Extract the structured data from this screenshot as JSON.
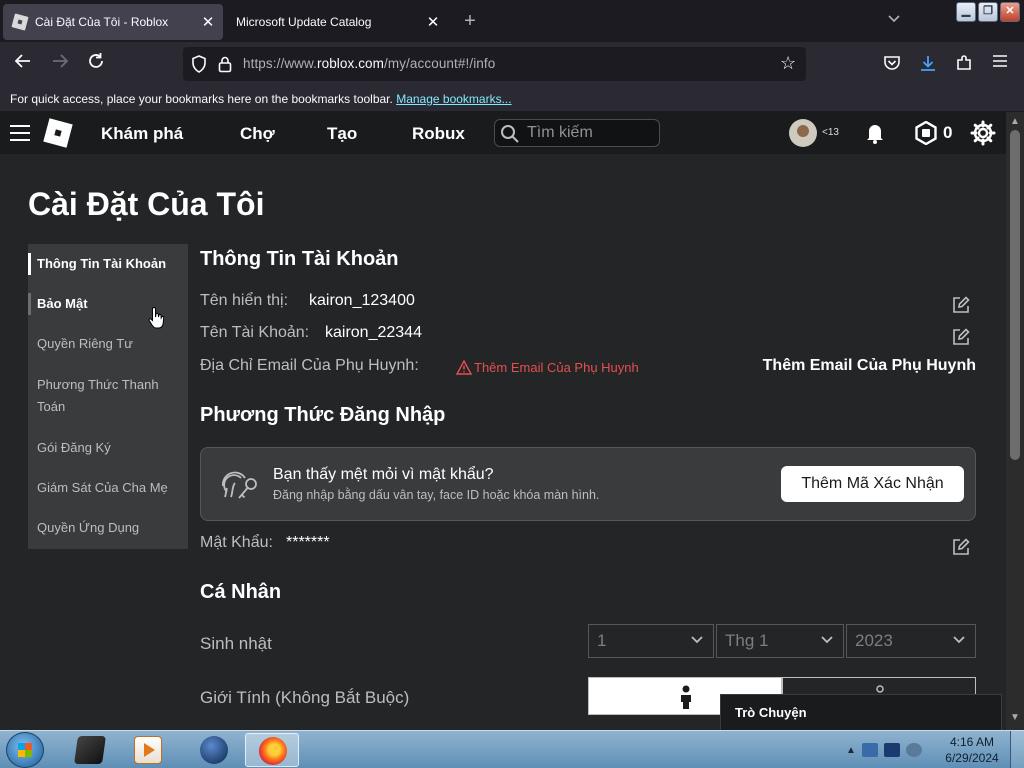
{
  "browser": {
    "tabs": [
      {
        "title": "Cài Đặt Của Tôi - Roblox",
        "active": true
      },
      {
        "title": "Microsoft Update Catalog",
        "active": false
      }
    ],
    "url_prefix": "https://www.",
    "url_host": "roblox.com",
    "url_path": "/my/account#!/info",
    "bookmarks_text": "For quick access, place your bookmarks here on the bookmarks toolbar.",
    "bookmarks_link": "Manage bookmarks..."
  },
  "header": {
    "nav": [
      "Khám phá",
      "Chợ",
      "Tạo",
      "Robux"
    ],
    "search_placeholder": "Tìm kiếm",
    "age_label": "<13",
    "robux_count": "0"
  },
  "page": {
    "title": "Cài Đặt Của Tôi",
    "sidebar": [
      {
        "label": "Thông Tin Tài Khoản",
        "state": "active"
      },
      {
        "label": "Bảo Mật",
        "state": "hover"
      },
      {
        "label": "Quyền Riêng Tư",
        "state": "normal"
      },
      {
        "label": "Phương Thức Thanh Toán",
        "state": "normal"
      },
      {
        "label": "Gói Đăng Ký",
        "state": "normal"
      },
      {
        "label": "Giám Sát Của Cha Mẹ",
        "state": "normal"
      },
      {
        "label": "Quyền Ứng Dụng",
        "state": "normal"
      }
    ],
    "account_info": {
      "title": "Thông Tin Tài Khoản",
      "display_name_label": "Tên hiển thị:",
      "display_name": "kairon_123400",
      "username_label": "Tên Tài Khoản:",
      "username": "kairon_22344",
      "parent_email_label": "Địa Chỉ Email Của Phụ Huynh:",
      "parent_email_warning": "Thêm Email Của Phụ Huynh",
      "parent_email_action": "Thêm Email Của Phụ Huynh"
    },
    "login_methods": {
      "title": "Phương Thức Đăng Nhập",
      "passkey_title": "Bạn thấy mệt mỏi vì mật khẩu?",
      "passkey_subtitle": "Đăng nhập bằng dấu vân tay, face ID hoặc khóa màn hình.",
      "passkey_button": "Thêm Mã Xác Nhận",
      "password_label": "Mật Khẩu:",
      "password_value": "*******"
    },
    "personal": {
      "title": "Cá Nhân",
      "birthday_label": "Sinh nhật",
      "birthday_day": "1",
      "birthday_month": "Thg 1",
      "birthday_year": "2023",
      "gender_label": "Giới Tính (Không Bắt Buộc)"
    },
    "chat_label": "Trò Chuyện"
  },
  "taskbar": {
    "time": "4:16 AM",
    "date": "6/29/2024"
  },
  "colors": {
    "page_bg": "#232527",
    "header_bg": "#191b1d",
    "sidebar_bg": "#393b3d",
    "warning": "#e64f4f"
  }
}
